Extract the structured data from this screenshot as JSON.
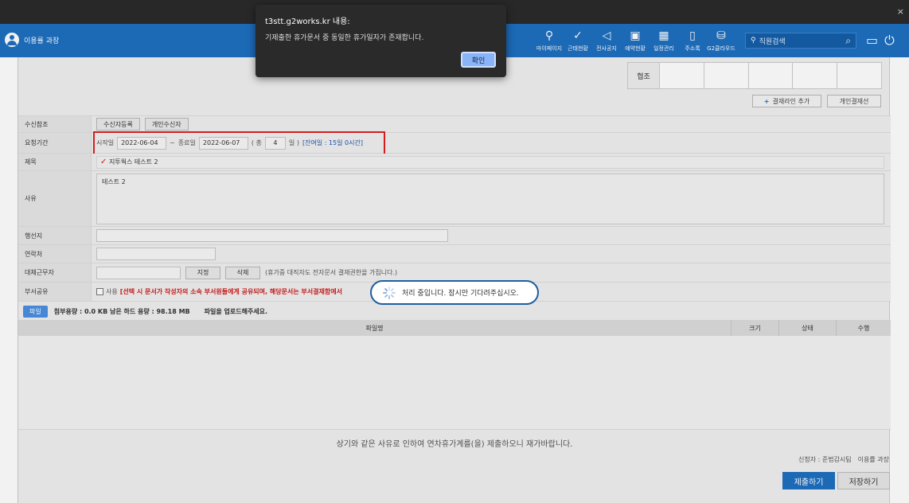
{
  "window": {
    "close": "×"
  },
  "header": {
    "user": "이용률 과장",
    "nav": [
      {
        "label": "마이페이지",
        "icon": "person-icon",
        "glyph": "⚲"
      },
      {
        "label": "근태현황",
        "icon": "check-circle-icon",
        "glyph": "✓"
      },
      {
        "label": "전사공지",
        "icon": "megaphone-icon",
        "glyph": "◁"
      },
      {
        "label": "예약현황",
        "icon": "calendar-check-icon",
        "glyph": "▣"
      },
      {
        "label": "일정관리",
        "icon": "calendar-icon",
        "glyph": "▦"
      },
      {
        "label": "주소록",
        "icon": "address-book-icon",
        "glyph": "▯"
      },
      {
        "label": "G2클라우드",
        "icon": "cloud-drive-icon",
        "glyph": "⛁"
      }
    ],
    "search_placeholder": "직원검색"
  },
  "approval": {
    "label": "협조"
  },
  "buttons": {
    "add_line": "결재라인 추가",
    "personal_line": "개인결재선"
  },
  "form": {
    "recipients": {
      "label": "수신참조",
      "register": "수신자등록",
      "personal": "개인수신자"
    },
    "period": {
      "label": "요청기간",
      "start_label": "시작일",
      "start": "2022-06-04",
      "tilde": "~",
      "end_label": "종료일",
      "end": "2022-06-07",
      "total_open": "( 총",
      "days": "4",
      "days_unit": "일 )",
      "remaining": "[잔여일 : 15일 0시간]"
    },
    "title": {
      "label": "제목",
      "value": "지투웍스 테스트 2"
    },
    "reason": {
      "label": "사유",
      "value": "테스트 2"
    },
    "destination": {
      "label": "행선지"
    },
    "contact": {
      "label": "연락처"
    },
    "substitute": {
      "label": "대체근무자",
      "assign": "지정",
      "delete": "삭제",
      "note": "(휴가중 대직자도 전자문서 결재권한을 가집니다.)"
    },
    "share": {
      "label": "부서공유",
      "use": "사용",
      "note": "[선택 시 문서가 작성자의 소속 부서원들에게 공유되며, 해당문서는 부서결재함에서"
    }
  },
  "files": {
    "button": "파일",
    "usage": "첨부용량 : 0.0 KB 남은 하드 용량 : 98.18 MB",
    "hint": "파일을 업로드해주세요.",
    "columns": [
      "파일명",
      "크기",
      "상태",
      "수행"
    ]
  },
  "declaration": "상기와 같은 사유로 인하여 연차휴가계를(을) 제출하오니 재가바랍니다.",
  "applicant": {
    "label": "신청자 : 준법감시팀",
    "name": "이용률 과장"
  },
  "actions": {
    "submit": "제출하기",
    "save": "저장하기"
  },
  "alert": {
    "title": "t3stt.g2works.kr 내용:",
    "message": "기제출한 휴가문서 중 동일한 휴가일자가 존재합니다.",
    "ok": "확인"
  },
  "loading": {
    "message": "처리 중입니다. 잠시만 기다려주십시오."
  }
}
